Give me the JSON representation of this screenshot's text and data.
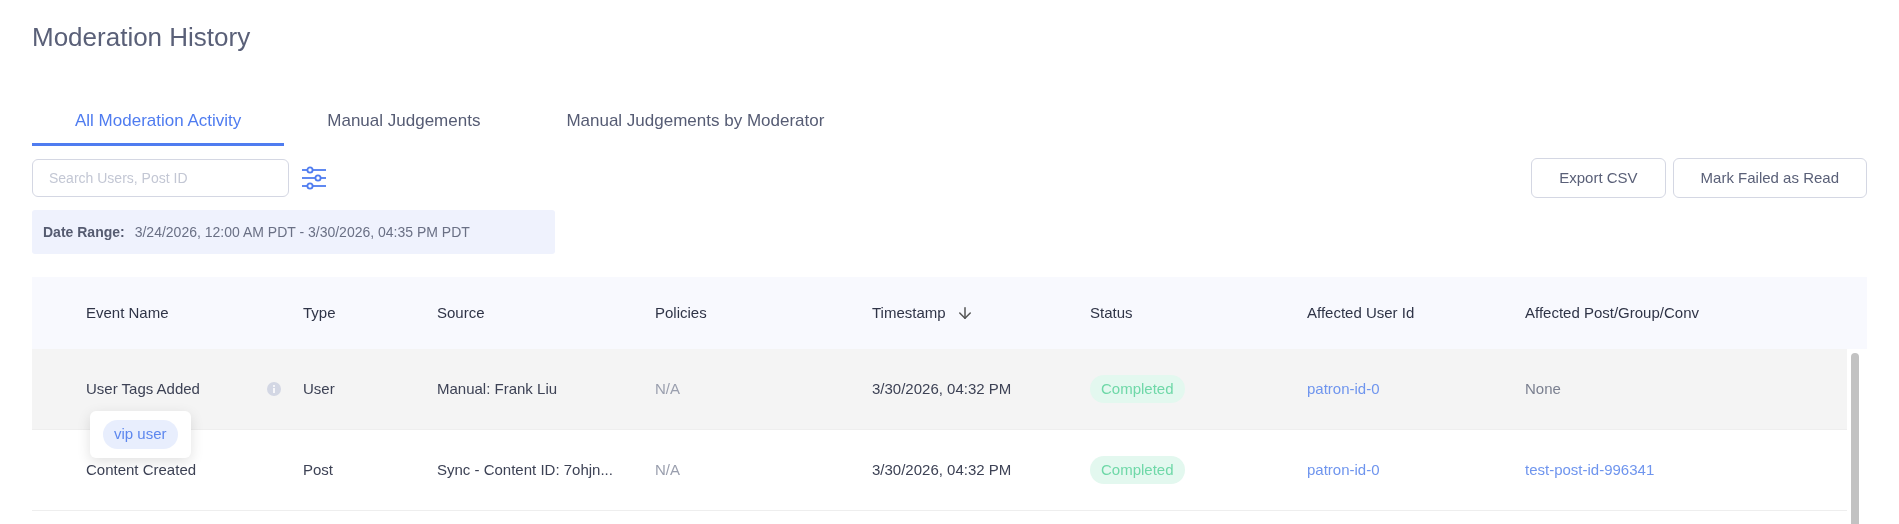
{
  "page": {
    "title": "Moderation History"
  },
  "tabs": [
    {
      "label": "All Moderation Activity",
      "selected": true
    },
    {
      "label": "Manual Judgements",
      "selected": false
    },
    {
      "label": "Manual Judgements by Moderator",
      "selected": false
    }
  ],
  "search": {
    "placeholder": "Search Users, Post ID"
  },
  "buttons": [
    "Export CSV",
    "Mark Failed as Read"
  ],
  "date_range": {
    "label": "Date Range:",
    "value": "3/24/2026, 12:00 AM PDT - 3/30/2026, 04:35 PM PDT"
  },
  "table": {
    "columns": [
      {
        "label": "Event Name",
        "sorted": false
      },
      {
        "label": "Type",
        "sorted": false
      },
      {
        "label": "Source",
        "sorted": false
      },
      {
        "label": "Policies",
        "sorted": false
      },
      {
        "label": "Timestamp",
        "sorted": true
      },
      {
        "label": "Status",
        "sorted": false
      },
      {
        "label": "Affected User Id",
        "sorted": false
      },
      {
        "label": "Affected Post/Group/Conv",
        "sorted": false
      }
    ],
    "rows": [
      {
        "hovered": true,
        "event": "User Tags Added",
        "info": true,
        "type": "User",
        "source": "Manual: Frank Liu",
        "policies": "N/A",
        "timestamp": "3/30/2026, 04:32 PM",
        "status": {
          "text": "Completed",
          "kind": "success"
        },
        "user": "patron-id-0",
        "post": {
          "text": "None",
          "link": false
        }
      },
      {
        "hovered": false,
        "event": "Content Created",
        "info": false,
        "type": "Post",
        "source": "Sync - Content ID: 7ohjn...",
        "policies": "N/A",
        "timestamp": "3/30/2026, 04:32 PM",
        "status": {
          "text": "Completed",
          "kind": "success"
        },
        "user": "patron-id-0",
        "post": {
          "text": "test-post-id-996341",
          "link": true
        }
      }
    ]
  },
  "popover": {
    "tags": [
      "vip user"
    ]
  }
}
